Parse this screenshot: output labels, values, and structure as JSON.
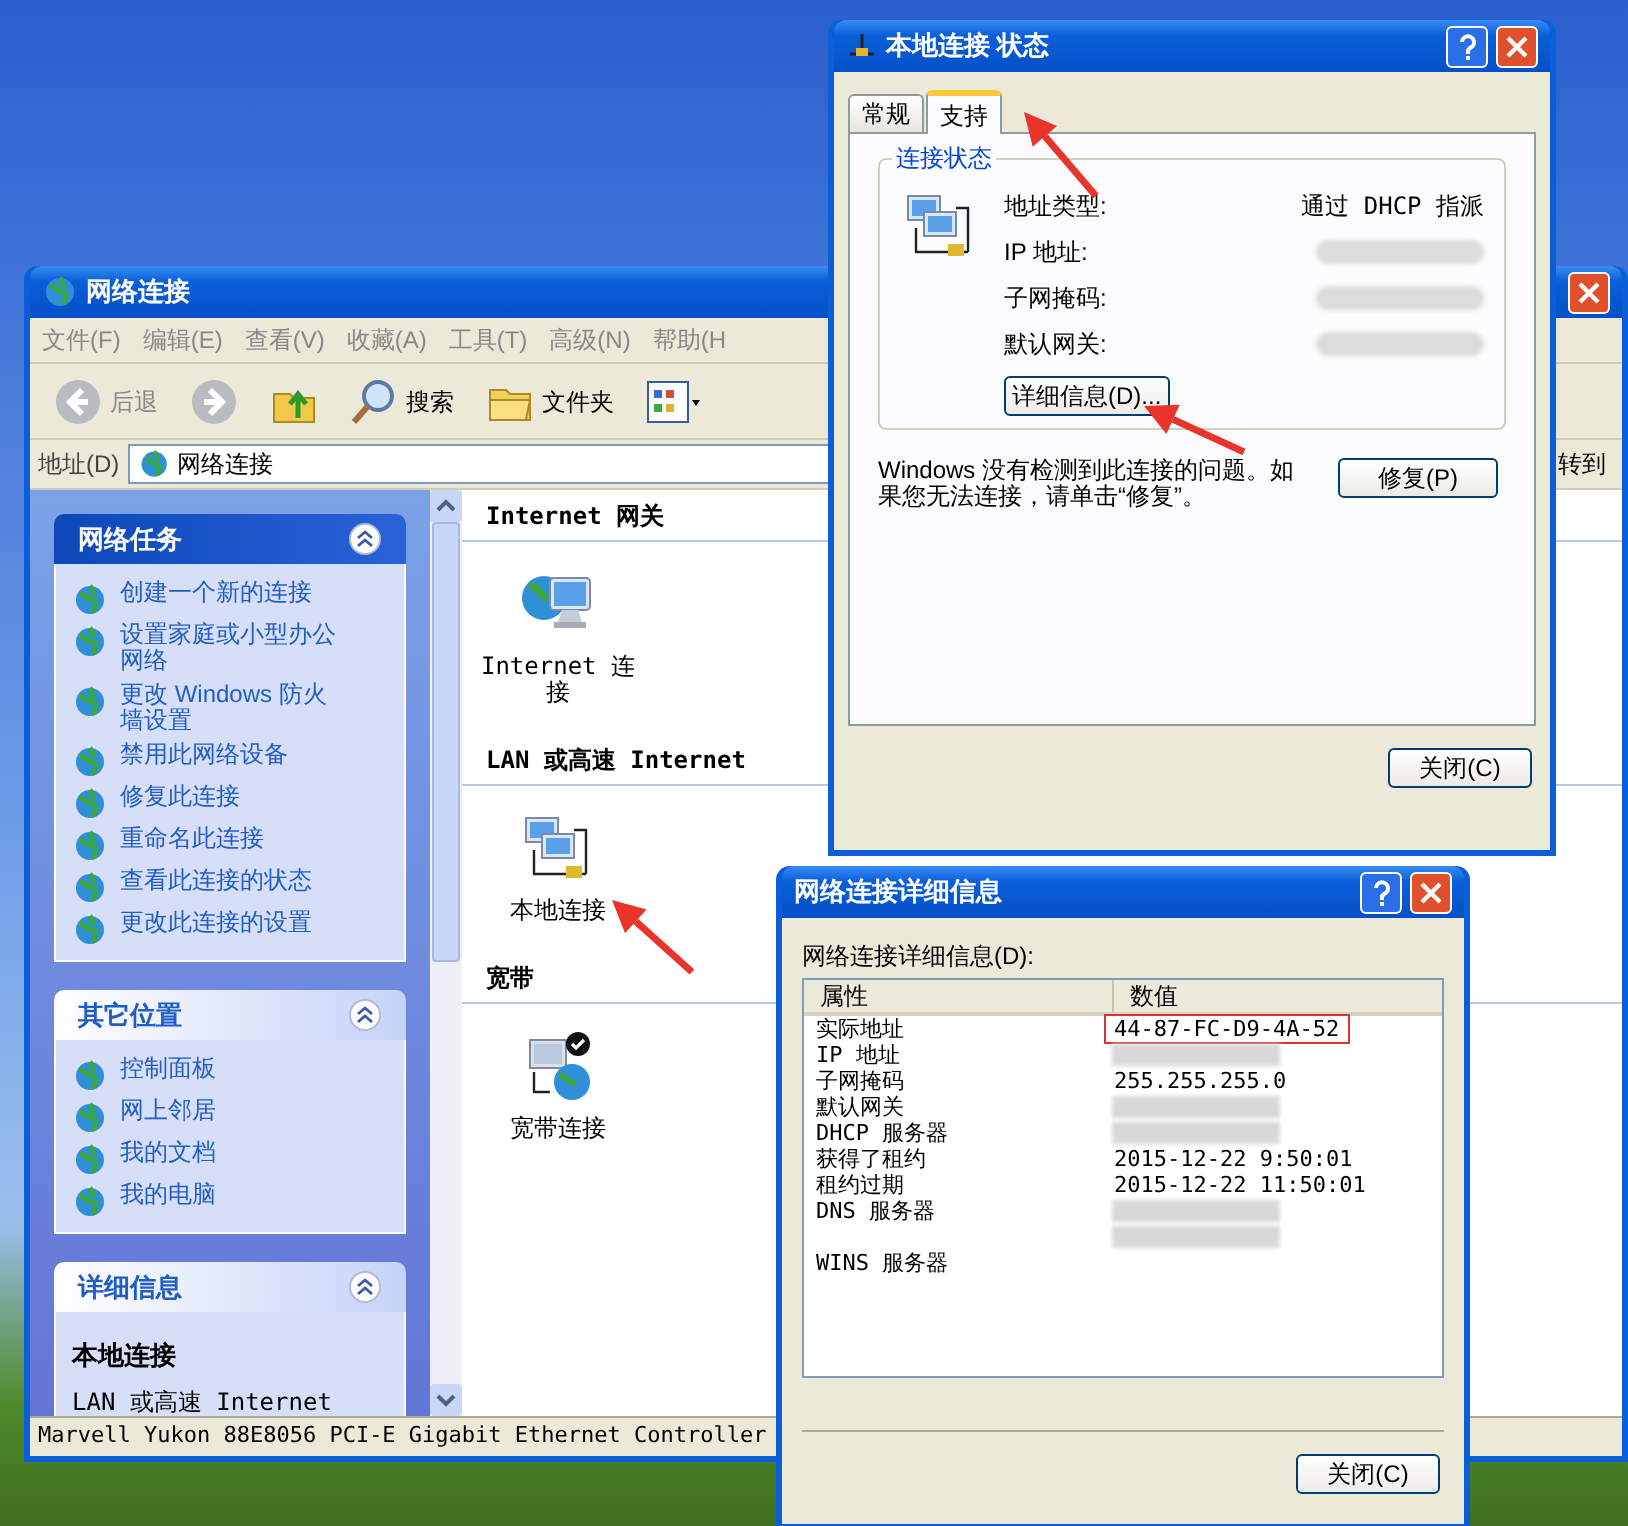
{
  "explorer": {
    "title": "网络连接",
    "menu": [
      "文件(F)",
      "编辑(E)",
      "查看(V)",
      "收藏(A)",
      "工具(T)",
      "高级(N)",
      "帮助(H"
    ],
    "toolbar": [
      {
        "kind": "back",
        "label": "后退"
      },
      {
        "kind": "forward"
      },
      {
        "kind": "up"
      },
      {
        "kind": "search",
        "label": "搜索"
      },
      {
        "kind": "folders",
        "label": "文件夹"
      },
      {
        "kind": "views"
      }
    ],
    "address": {
      "label": "地址(D)",
      "value": "网络连接",
      "go": "转到"
    },
    "task_panels": [
      {
        "kind": "special",
        "title": "网络任务",
        "items": [
          "创建一个新的连接",
          "设置家庭或小型办公网络",
          "更改 Windows 防火墙设置",
          "禁用此网络设备",
          "修复此连接",
          "重命名此连接",
          "查看此连接的状态",
          "更改此连接的设置"
        ]
      },
      {
        "kind": "normal",
        "title": "其它位置",
        "items": [
          "控制面板",
          "网上邻居",
          "我的文档",
          "我的电脑"
        ]
      },
      {
        "kind": "normal",
        "title": "详细信息",
        "heading": "本地连接",
        "lines": [
          "LAN 或高速 Internet"
        ]
      }
    ],
    "groups": [
      {
        "title": "Internet 网关",
        "items": [
          {
            "kind": "gateway",
            "label": "Internet 连接"
          }
        ]
      },
      {
        "title": "LAN 或高速 Internet",
        "items": [
          {
            "kind": "lan",
            "label": "本地连接"
          }
        ]
      },
      {
        "title": "宽带",
        "items": [
          {
            "kind": "broadband",
            "label": "宽带连接"
          }
        ]
      }
    ],
    "status_bar": "Marvell Yukon 88E8056 PCI-E Gigabit Ethernet Controller"
  },
  "status_window": {
    "title": "本地连接 状态",
    "tabs": [
      {
        "label": "常规",
        "selected": false
      },
      {
        "label": "支持",
        "selected": true
      }
    ],
    "group_title": "连接状态",
    "rows": [
      {
        "label": "地址类型:",
        "value": "通过 DHCP 指派"
      },
      {
        "label": "IP 地址:",
        "redacted": true
      },
      {
        "label": "子网掩码:",
        "redacted": true
      },
      {
        "label": "默认网关:",
        "redacted": true
      }
    ],
    "details_button": "详细信息(D)...",
    "message": "Windows 没有检测到此连接的问题。如果您无法连接，请单击“修复”。",
    "repair_button": "修复(P)",
    "close_button": "关闭(C)"
  },
  "details_window": {
    "title": "网络连接详细信息",
    "list_label": "网络连接详细信息(D):",
    "columns": [
      "属性",
      "数值"
    ],
    "rows": [
      {
        "property": "实际地址",
        "value": "44-87-FC-D9-4A-52",
        "highlighted": true
      },
      {
        "property": "IP 地址",
        "redacted": true
      },
      {
        "property": "子网掩码",
        "value": "255.255.255.0"
      },
      {
        "property": "默认网关",
        "redacted": true
      },
      {
        "property": "DHCP 服务器",
        "redacted": true
      },
      {
        "property": "获得了租约",
        "value": "2015-12-22 9:50:01"
      },
      {
        "property": "租约过期",
        "value": "2015-12-22 11:50:01"
      },
      {
        "property": "DNS 服务器",
        "redacted": true
      },
      {
        "redacted": true
      },
      {
        "property": "WINS 服务器"
      }
    ],
    "close_button": "关闭(C)"
  }
}
